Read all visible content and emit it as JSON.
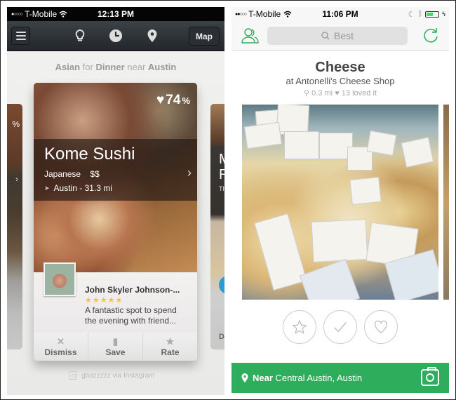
{
  "left_screen": {
    "status_bar": {
      "carrier": "T-Mobile",
      "signal_dots": "●○○○○",
      "time": "12:13 PM"
    },
    "nav": {
      "map_label": "Map"
    },
    "subtitle": {
      "cuisine": "Asian",
      "for": "for",
      "meal": "Dinner",
      "near": "near",
      "place": "Austin"
    },
    "card": {
      "like_percent": "74",
      "percent_sign": "%",
      "name": "Kome Sushi",
      "cuisine": "Japanese",
      "price": "$$",
      "location": "Austin - 31.3 mi",
      "review": {
        "author": "John Skyler Johnson-...",
        "rating": 5,
        "stars": "★★★★★",
        "text": "A fantastic spot to spend the evening with friend..."
      },
      "actions": [
        {
          "label": "Dismiss",
          "icon": "✕"
        },
        {
          "label": "Save",
          "icon": "▮"
        },
        {
          "label": "Rate",
          "icon": "★"
        }
      ]
    },
    "side_left": {
      "pct": "%",
      "chev": "›"
    },
    "side_right": {
      "title": "M\nR",
      "t1": "M",
      "t2": "R",
      "sub": "Th",
      "action": "D"
    },
    "credit": "gbazzzzz via Instagram"
  },
  "right_screen": {
    "status_bar": {
      "carrier": "T-Mobile",
      "signal_dots": "●●○○○",
      "time": "11:06 PM"
    },
    "search": {
      "placeholder": "Best"
    },
    "item": {
      "title": "Cheese",
      "venue": "at Antonelli's Cheese Shop",
      "distance": "0.3 mi",
      "loved": "13 loved it"
    },
    "near_bar": {
      "prefix": "Near",
      "location": "Central Austin, Austin"
    },
    "colors": {
      "accent": "#2eae5d"
    }
  }
}
